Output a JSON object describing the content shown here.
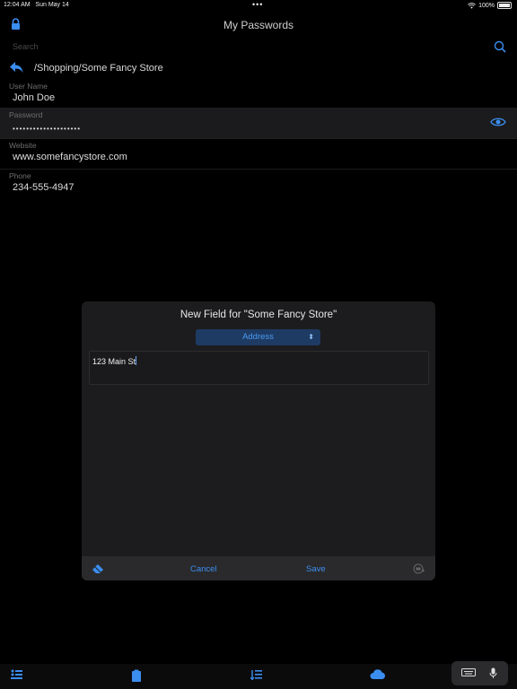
{
  "status_bar": {
    "time": "12:04 AM",
    "date": "Sun May 14",
    "battery": "100%"
  },
  "header": {
    "title": "My Passwords"
  },
  "search": {
    "placeholder": "Search"
  },
  "breadcrumb": {
    "path": "/Shopping/Some Fancy Store"
  },
  "fields": [
    {
      "label": "User Name",
      "value": "John Doe"
    },
    {
      "label": "Password",
      "value": "••••••••••••••••••••"
    },
    {
      "label": "Website",
      "value": "www.somefancystore.com"
    },
    {
      "label": "Phone",
      "value": "234-555-4947"
    }
  ],
  "dialog": {
    "title": "New Field for \"Some Fancy Store\"",
    "field_type": "Address",
    "text_value": "123 Main St",
    "cancel_label": "Cancel",
    "save_label": "Save"
  },
  "colors": {
    "accent": "#3b8ef0",
    "background": "#000000",
    "dialog": "#1c1c1e"
  }
}
